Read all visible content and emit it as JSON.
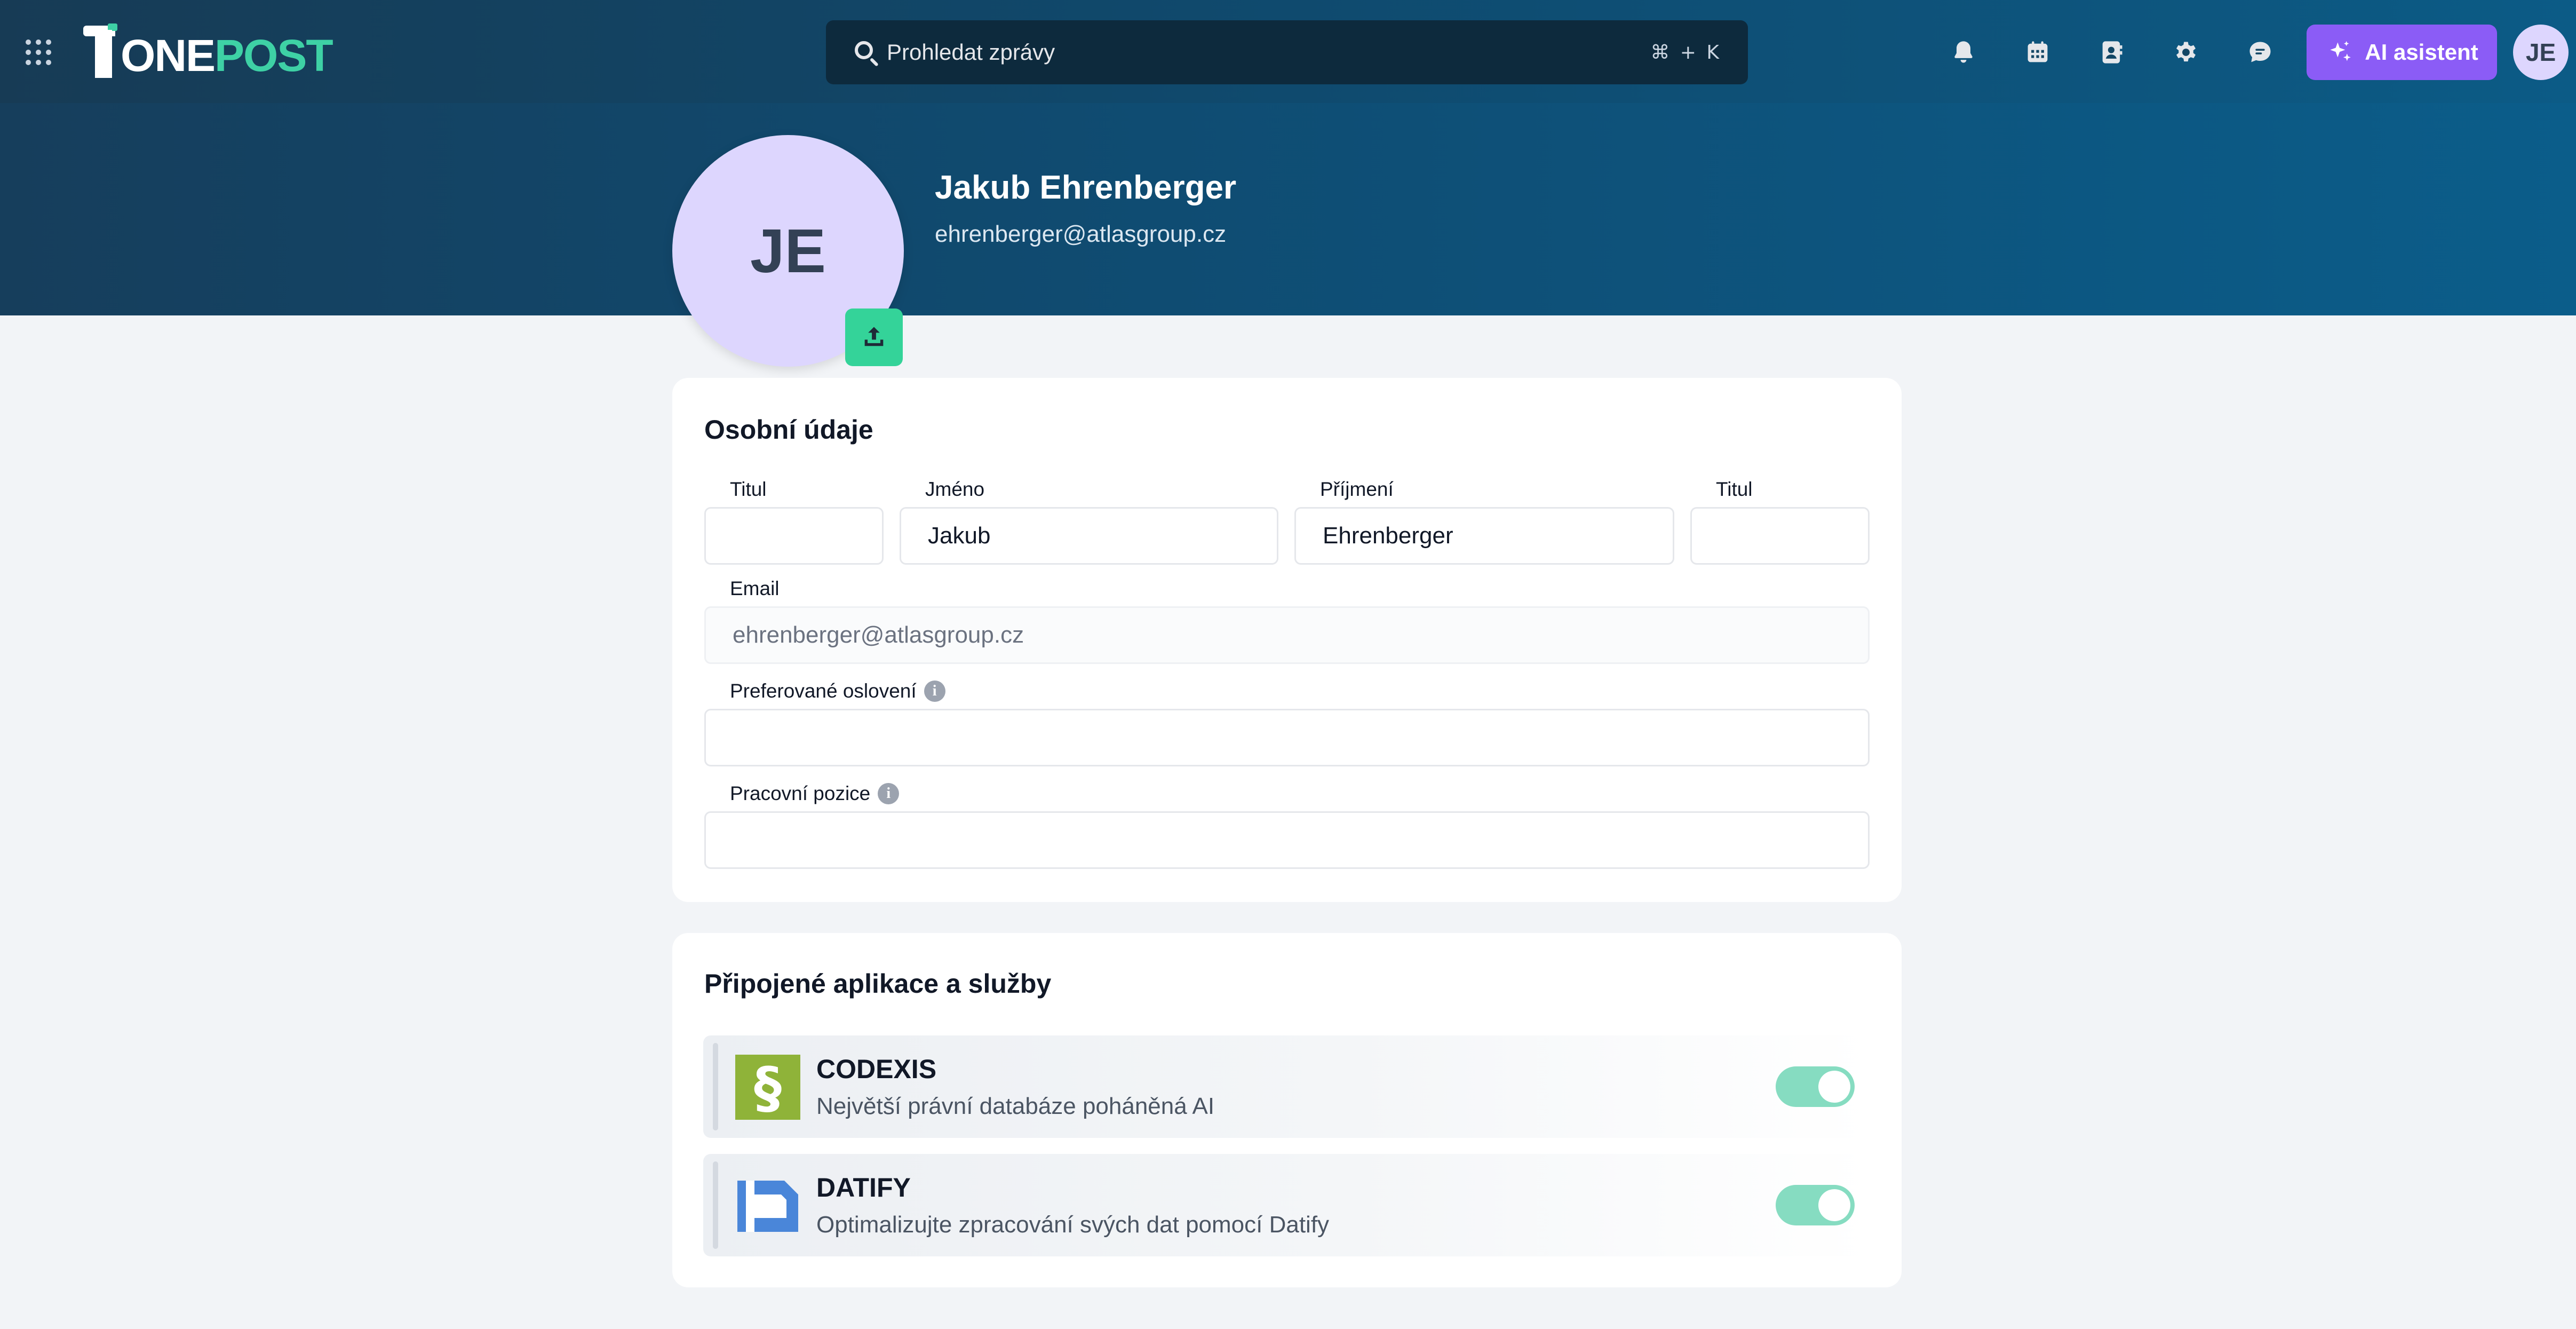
{
  "app": {
    "logo_part1": "ONE",
    "logo_part2": "POST"
  },
  "header": {
    "search_placeholder": "Prohledat zprávy",
    "search_shortcut": "⌘ + K",
    "icons": [
      "bell-icon",
      "calendar-icon",
      "contacts-icon",
      "gear-icon",
      "chat-icon"
    ],
    "ai_button_label": "AI asistent",
    "user_initials": "JE"
  },
  "profile": {
    "initials": "JE",
    "name": "Jakub Ehrenberger",
    "email": "ehrenberger@atlasgroup.cz"
  },
  "personal": {
    "title": "Osobní údaje",
    "titul_before_label": "Titul",
    "titul_before_value": "",
    "first_name_label": "Jméno",
    "first_name_value": "Jakub",
    "last_name_label": "Příjmení",
    "last_name_value": "Ehrenberger",
    "titul_after_label": "Titul",
    "titul_after_value": "",
    "email_label": "Email",
    "email_value": "ehrenberger@atlasgroup.cz",
    "salutation_label": "Preferované oslovení",
    "salutation_value": "",
    "position_label": "Pracovní pozice",
    "position_value": ""
  },
  "apps": {
    "title": "Připojené aplikace a služby",
    "items": [
      {
        "name": "CODEXIS",
        "description": "Největší právní databáze poháněná AI",
        "enabled": true,
        "logo_color": "#8fb339"
      },
      {
        "name": "DATIFY",
        "description": "Optimalizujte zpracování svých dat pomocí Datify",
        "enabled": true,
        "logo_color": "#4a86d9"
      }
    ]
  },
  "colors": {
    "accent_green": "#3ed1a5",
    "ai_purple": "#8b5cf6",
    "toggle_on": "#86dcc1"
  }
}
